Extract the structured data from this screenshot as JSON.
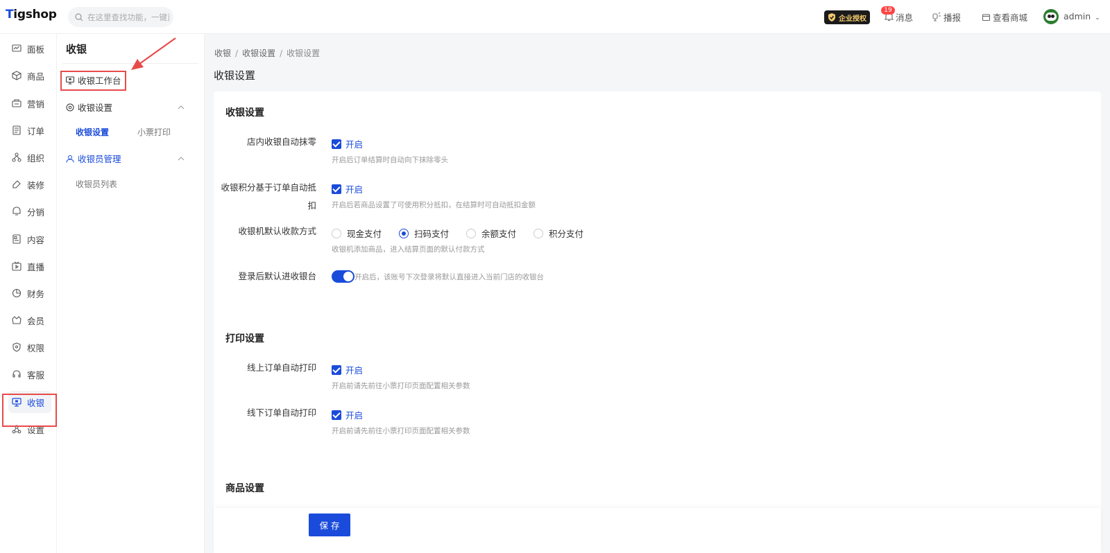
{
  "header": {
    "logo_text": "Tigshop",
    "search_placeholder": "在这里查找功能，一键直达",
    "auth_badge": "企业授权",
    "message_count": "19",
    "message_label": "消息",
    "broadcast_label": "播报",
    "view_store_label": "查看商城",
    "user_name": "admin"
  },
  "leftnav": {
    "items": [
      {
        "label": "面板",
        "icon": "dashboard-icon"
      },
      {
        "label": "商品",
        "icon": "box-icon"
      },
      {
        "label": "营销",
        "icon": "marketing-icon"
      },
      {
        "label": "订单",
        "icon": "order-icon"
      },
      {
        "label": "组织",
        "icon": "org-icon"
      },
      {
        "label": "装修",
        "icon": "decorate-icon"
      },
      {
        "label": "分销",
        "icon": "distribution-icon"
      },
      {
        "label": "内容",
        "icon": "content-icon"
      },
      {
        "label": "直播",
        "icon": "live-icon"
      },
      {
        "label": "财务",
        "icon": "finance-icon"
      },
      {
        "label": "会员",
        "icon": "member-icon"
      },
      {
        "label": "权限",
        "icon": "permission-icon"
      },
      {
        "label": "客服",
        "icon": "service-icon"
      },
      {
        "label": "收银",
        "icon": "cashier-icon"
      },
      {
        "label": "设置",
        "icon": "settings-icon"
      }
    ],
    "active_index": 13
  },
  "subnav": {
    "title": "收银",
    "workbench": "收银工作台",
    "cashier_settings_group": "收银设置",
    "cashier_settings_link": "收银设置",
    "receipt_print_link": "小票打印",
    "cashier_staff_group": "收银员管理",
    "cashier_list_link": "收银员列表"
  },
  "main": {
    "breadcrumb": [
      "收银",
      "收银设置",
      "收银设置"
    ],
    "page_title": "收银设置",
    "card1": {
      "title": "收银设置",
      "auto_zero_label": "店内收银自动抹零",
      "auto_zero_option": "开启",
      "auto_zero_hint": "开启后订单结算时自动向下抹除零头",
      "points_label_line1": "收银积分基于订单自动抵",
      "points_label_line2": "扣",
      "points_option": "开启",
      "points_hint": "开启后若商品设置了可使用积分抵扣，在结算时可自动抵扣金额",
      "pay_method_label": "收银机默认收款方式",
      "pay_methods": [
        "现金支付",
        "扫码支付",
        "余额支付",
        "积分支付"
      ],
      "pay_method_selected": 1,
      "pay_method_hint": "收银机添加商品，进入结算页面的默认付款方式",
      "login_label": "登录后默认进收银台",
      "login_hint": "开启后，该账号下次登录将默认直接进入当前门店的收银台"
    },
    "card2": {
      "title": "打印设置",
      "online_label": "线上订单自动打印",
      "online_option": "开启",
      "online_hint": "开启前请先前往小票打印页面配置相关参数",
      "offline_label": "线下订单自动打印",
      "offline_option": "开启",
      "offline_hint": "开启前请先前往小票打印页面配置相关参数"
    },
    "card3": {
      "title": "商品设置"
    },
    "save_label": "保存"
  },
  "colors": {
    "accent": "#1a4bdb",
    "highlight_box": "#e84a4a"
  }
}
